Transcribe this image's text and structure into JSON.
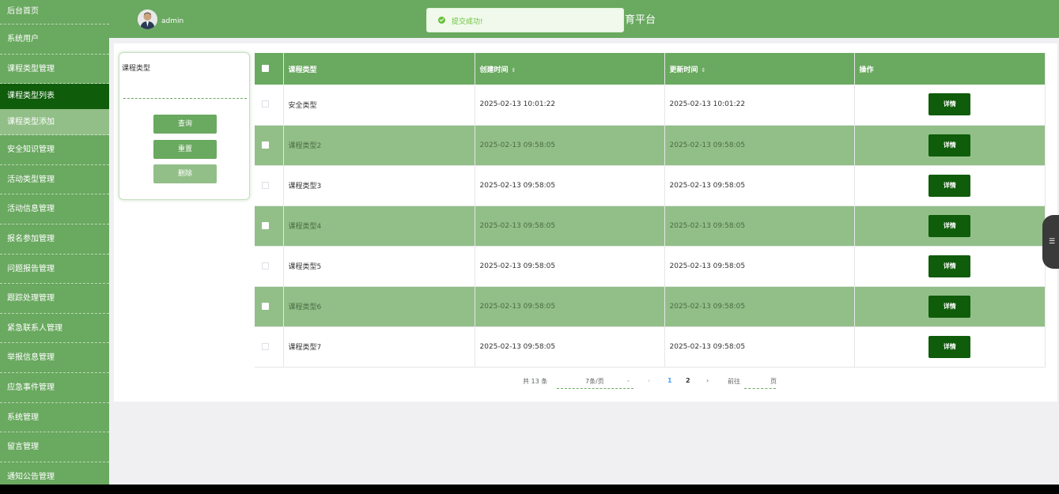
{
  "sidebar": {
    "items": [
      {
        "label": "后台首页"
      },
      {
        "label": "系统用户"
      },
      {
        "label": "课程类型管理"
      },
      {
        "label": "课程类型列表"
      },
      {
        "label": "课程类型添加"
      },
      {
        "label": "安全知识管理"
      },
      {
        "label": "活动类型管理"
      },
      {
        "label": "活动信息管理"
      },
      {
        "label": "报名参加管理"
      },
      {
        "label": "问题报告管理"
      },
      {
        "label": "跟踪处理管理"
      },
      {
        "label": "紧急联系人管理"
      },
      {
        "label": "举报信息管理"
      },
      {
        "label": "应急事件管理"
      },
      {
        "label": "系统管理"
      },
      {
        "label": "留言管理"
      },
      {
        "label": "通知公告管理"
      }
    ]
  },
  "header": {
    "username": "admin",
    "title_visible": "育平台",
    "toast": "提交成功!"
  },
  "search": {
    "label": "课程类型",
    "value": "",
    "query_label": "查询",
    "reset_label": "重置",
    "delete_label": "删除"
  },
  "table": {
    "columns": [
      "课程类型",
      "创建时间",
      "更新时间",
      "操作"
    ],
    "sort_glyph": "⇕",
    "detail_label": "详情",
    "rows": [
      {
        "type": "安全类型",
        "created": "2025-02-13 10:01:22",
        "updated": "2025-02-13 10:01:22"
      },
      {
        "type": "课程类型2",
        "created": "2025-02-13 09:58:05",
        "updated": "2025-02-13 09:58:05"
      },
      {
        "type": "课程类型3",
        "created": "2025-02-13 09:58:05",
        "updated": "2025-02-13 09:58:05"
      },
      {
        "type": "课程类型4",
        "created": "2025-02-13 09:58:05",
        "updated": "2025-02-13 09:58:05"
      },
      {
        "type": "课程类型5",
        "created": "2025-02-13 09:58:05",
        "updated": "2025-02-13 09:58:05"
      },
      {
        "type": "课程类型6",
        "created": "2025-02-13 09:58:05",
        "updated": "2025-02-13 09:58:05"
      },
      {
        "type": "课程类型7",
        "created": "2025-02-13 09:58:05",
        "updated": "2025-02-13 09:58:05"
      }
    ]
  },
  "pagination": {
    "total": "共 13 条",
    "page_size": "7条/页",
    "prev": "‹",
    "page1": "1",
    "page2": "2",
    "next": "›",
    "goto": "前往",
    "page_unit": "页",
    "dropdown_glyph": "⌄"
  },
  "colors": {
    "primary": "#6aa960",
    "dark": "#0f5c0a",
    "light": "#92bf88"
  }
}
